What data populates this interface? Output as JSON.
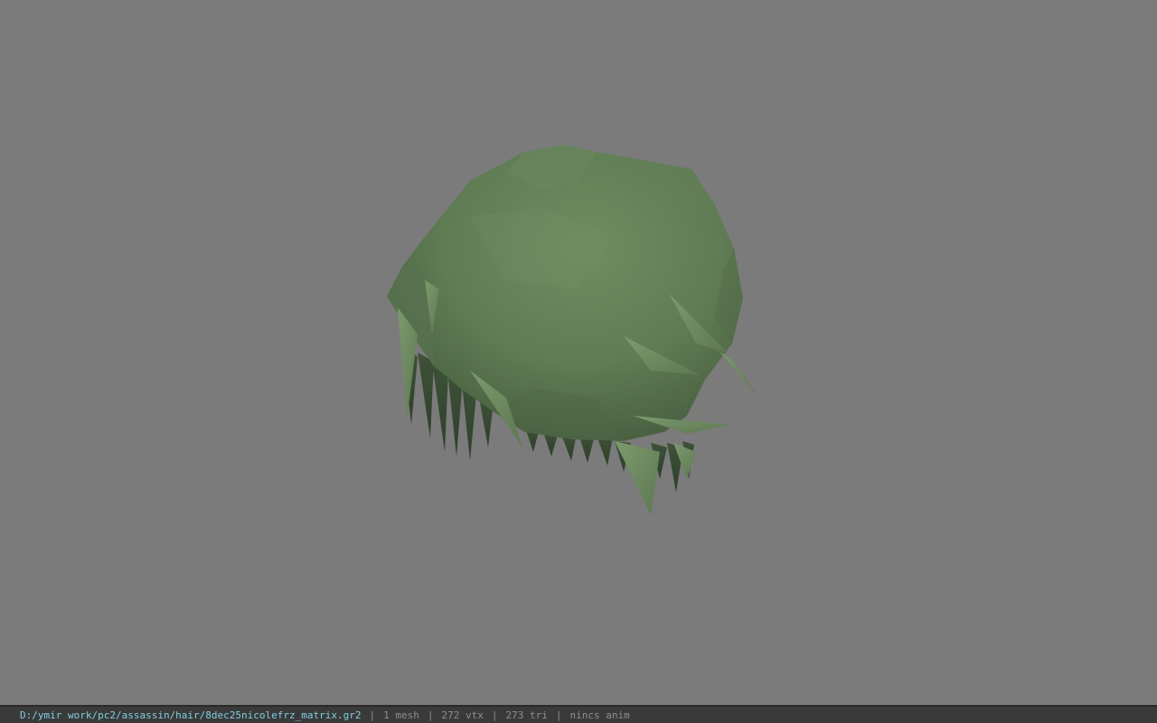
{
  "viewport": {
    "background_color": "#7b7b7b",
    "model_color": "#5f7a53",
    "model": "hair-mesh"
  },
  "status_bar": {
    "file_path": "D:/ymir work/pc2/assassin/hair/8dec25nicolefrz_matrix.gr2",
    "separator": "|",
    "mesh_count": "1 mesh",
    "vertex_count": "272 vtx",
    "triangle_count": "273 tri",
    "animation": "nincs anim"
  }
}
